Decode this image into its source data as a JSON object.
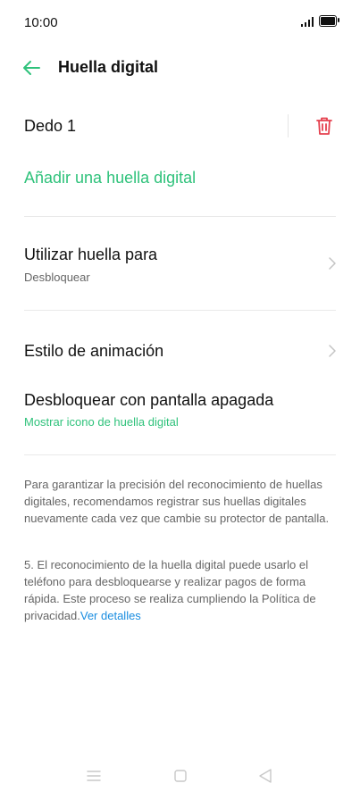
{
  "status": {
    "time": "10:00"
  },
  "header": {
    "title": "Huella digital"
  },
  "fingerprint": {
    "label": "Dedo 1"
  },
  "add_link": "Añadir una huella digital",
  "use_for": {
    "title": "Utilizar huella para",
    "value": "Desbloquear"
  },
  "animation": {
    "title": "Estilo de animación"
  },
  "screen_off": {
    "title": "Desbloquear con pantalla apagada",
    "value": "Mostrar icono de huella digital"
  },
  "notes": {
    "first": "Para garantizar la precisión del reconocimiento de huellas digitales, recomendamos registrar sus huellas digitales nuevamente cada vez que cambie su protector de pantalla.",
    "second": "5. El reconocimiento de la huella digital puede usarlo el teléfono para desbloquearse y realizar pagos de forma rápida. Este proceso se realiza cumpliendo la Política de privacidad.",
    "link": "Ver detalles"
  },
  "colors": {
    "accent": "#2fc27b",
    "danger": "#e5404e",
    "link": "#1a8de0"
  },
  "icons": {
    "back": "back-arrow-icon",
    "trash": "trash-icon",
    "chevron": "chevron-right-icon",
    "nav_menu": "menu-icon",
    "nav_home": "home-icon",
    "nav_back": "back-triangle-icon"
  }
}
